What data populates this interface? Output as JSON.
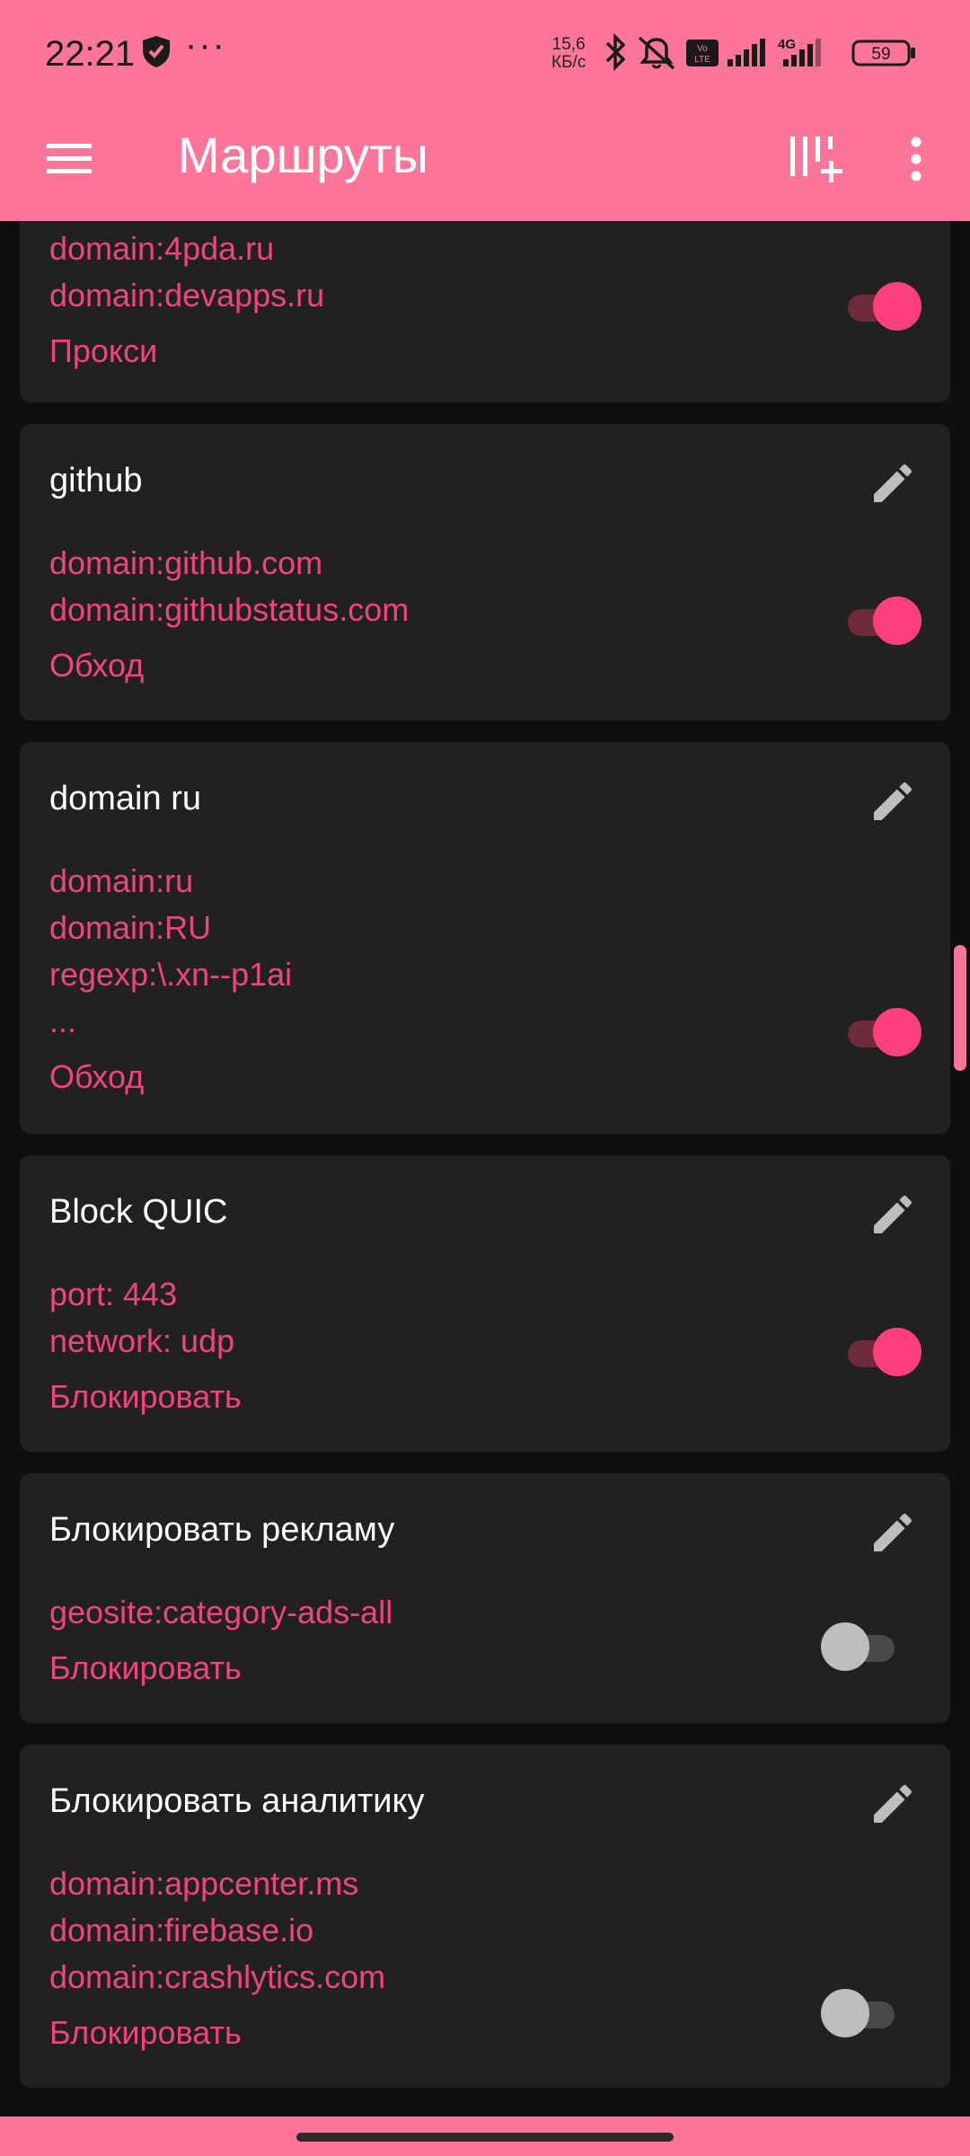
{
  "status_bar": {
    "time": "22:21",
    "dots": "···",
    "speed_value": "15,6",
    "speed_unit": "КБ/с",
    "network": "4G",
    "battery": "59",
    "icons": [
      "shield-icon",
      "bluetooth-icon",
      "mute-icon",
      "volte-icon",
      "signal-icon",
      "signal-4g-icon",
      "battery-icon"
    ]
  },
  "app_bar": {
    "title": "Маршруты",
    "icons": [
      "menu-icon",
      "add-rule-icon",
      "more-vert-icon"
    ]
  },
  "colors": {
    "accent": "#fd7699",
    "rule_text": "#f0457a",
    "card_bg": "#212121",
    "switch_on": "#ff3f7e"
  },
  "cards": [
    {
      "title": "",
      "rules": [
        "domain:4pda.ru",
        "domain:devapps.ru"
      ],
      "outbound": "Прокси",
      "enabled": true
    },
    {
      "title": "github",
      "rules": [
        "domain:github.com",
        "domain:githubstatus.com"
      ],
      "outbound": "Обход",
      "enabled": true
    },
    {
      "title": "domain ru",
      "rules": [
        "domain:ru",
        "domain:RU",
        "regexp:\\.xn--p1ai",
        "..."
      ],
      "outbound": "Обход",
      "enabled": true
    },
    {
      "title": "Block QUIC",
      "rules": [
        "port: 443",
        "network: udp"
      ],
      "outbound": "Блокировать",
      "enabled": true
    },
    {
      "title": "Блокировать рекламу",
      "rules": [
        "geosite:category-ads-all"
      ],
      "outbound": "Блокировать",
      "enabled": false
    },
    {
      "title": "Блокировать аналитику",
      "rules": [
        "domain:appcenter.ms",
        "domain:firebase.io",
        "domain:crashlytics.com"
      ],
      "outbound": "Блокировать",
      "enabled": false
    }
  ]
}
